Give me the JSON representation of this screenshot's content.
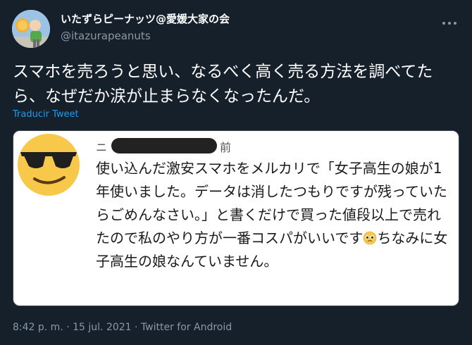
{
  "author": {
    "display_name": "いたずらピーナッツ@愛媛大家の会",
    "handle": "@itazurapeanuts",
    "avatar_icon": "avatar-photo"
  },
  "tweet": {
    "text": "スマホを売ろうと思い、なるべく高く売る方法を調べてたら、なぜだか涙が止まらなくなったんだ。",
    "translate_label": "Traducir Tweet",
    "more_icon": "more-options-icon"
  },
  "media": {
    "commenter_initial": "ニ",
    "header_suffix": "前",
    "comment_before_emoji": "使い込んだ激安スマホをメルカリで「女子高生の娘が1年使いました。データは消したつもりですが残っていたらごめんなさい。」と書くだけで買った値段以上で売れたので私のやり方が一番コスパがいいです",
    "comment_after_emoji": "ちなみに女子高生の娘なんていません。",
    "avatar_icon": "sunglasses-emoji-icon",
    "inline_icon": "pleading-face-emoji-icon"
  },
  "meta": {
    "time": "8:42 p. m.",
    "separator": "·",
    "date": "15 jul. 2021",
    "source": "Twitter for Android"
  },
  "colors": {
    "background": "#15202b",
    "secondary_text": "#8b98a5",
    "link": "#1d9bf0",
    "emoji_yellow": "#f7c84a"
  }
}
